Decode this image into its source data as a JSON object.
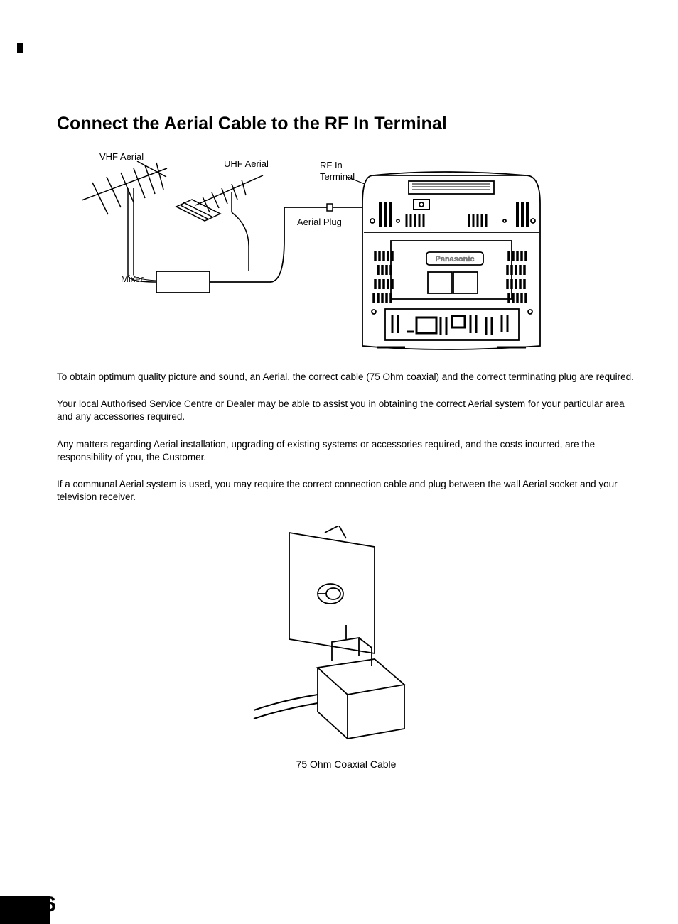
{
  "page": {
    "title": "Connect the Aerial Cable to the RF In Terminal",
    "page_number": "6",
    "paragraphs": [
      "To obtain optimum quality picture and sound, an Aerial, the correct cable (75 Ohm coaxial) and the correct terminating plug are required.",
      "Your local Authorised Service Centre or Dealer may be able to assist you in obtaining the correct Aerial system for your particular area and any accessories required.",
      "Any matters regarding Aerial installation, upgrading of existing systems or accessories required, and the costs incurred, are the responsibility of you, the Customer.",
      "If a communal Aerial system is used, you may require the correct connection cable and plug between the wall Aerial socket and your television receiver."
    ],
    "diagram_top": {
      "labels": {
        "vhf_aerial": "VHF Aerial",
        "uhf_aerial": "UHF Aerial",
        "rf_in_terminal_line1": "RF In",
        "rf_in_terminal_line2": "Terminal",
        "aerial_plug": "Aerial Plug",
        "mixer": "Mixer",
        "brand": "Panasonic"
      }
    },
    "diagram_bottom": {
      "caption": "75 Ohm Coaxial Cable"
    }
  }
}
